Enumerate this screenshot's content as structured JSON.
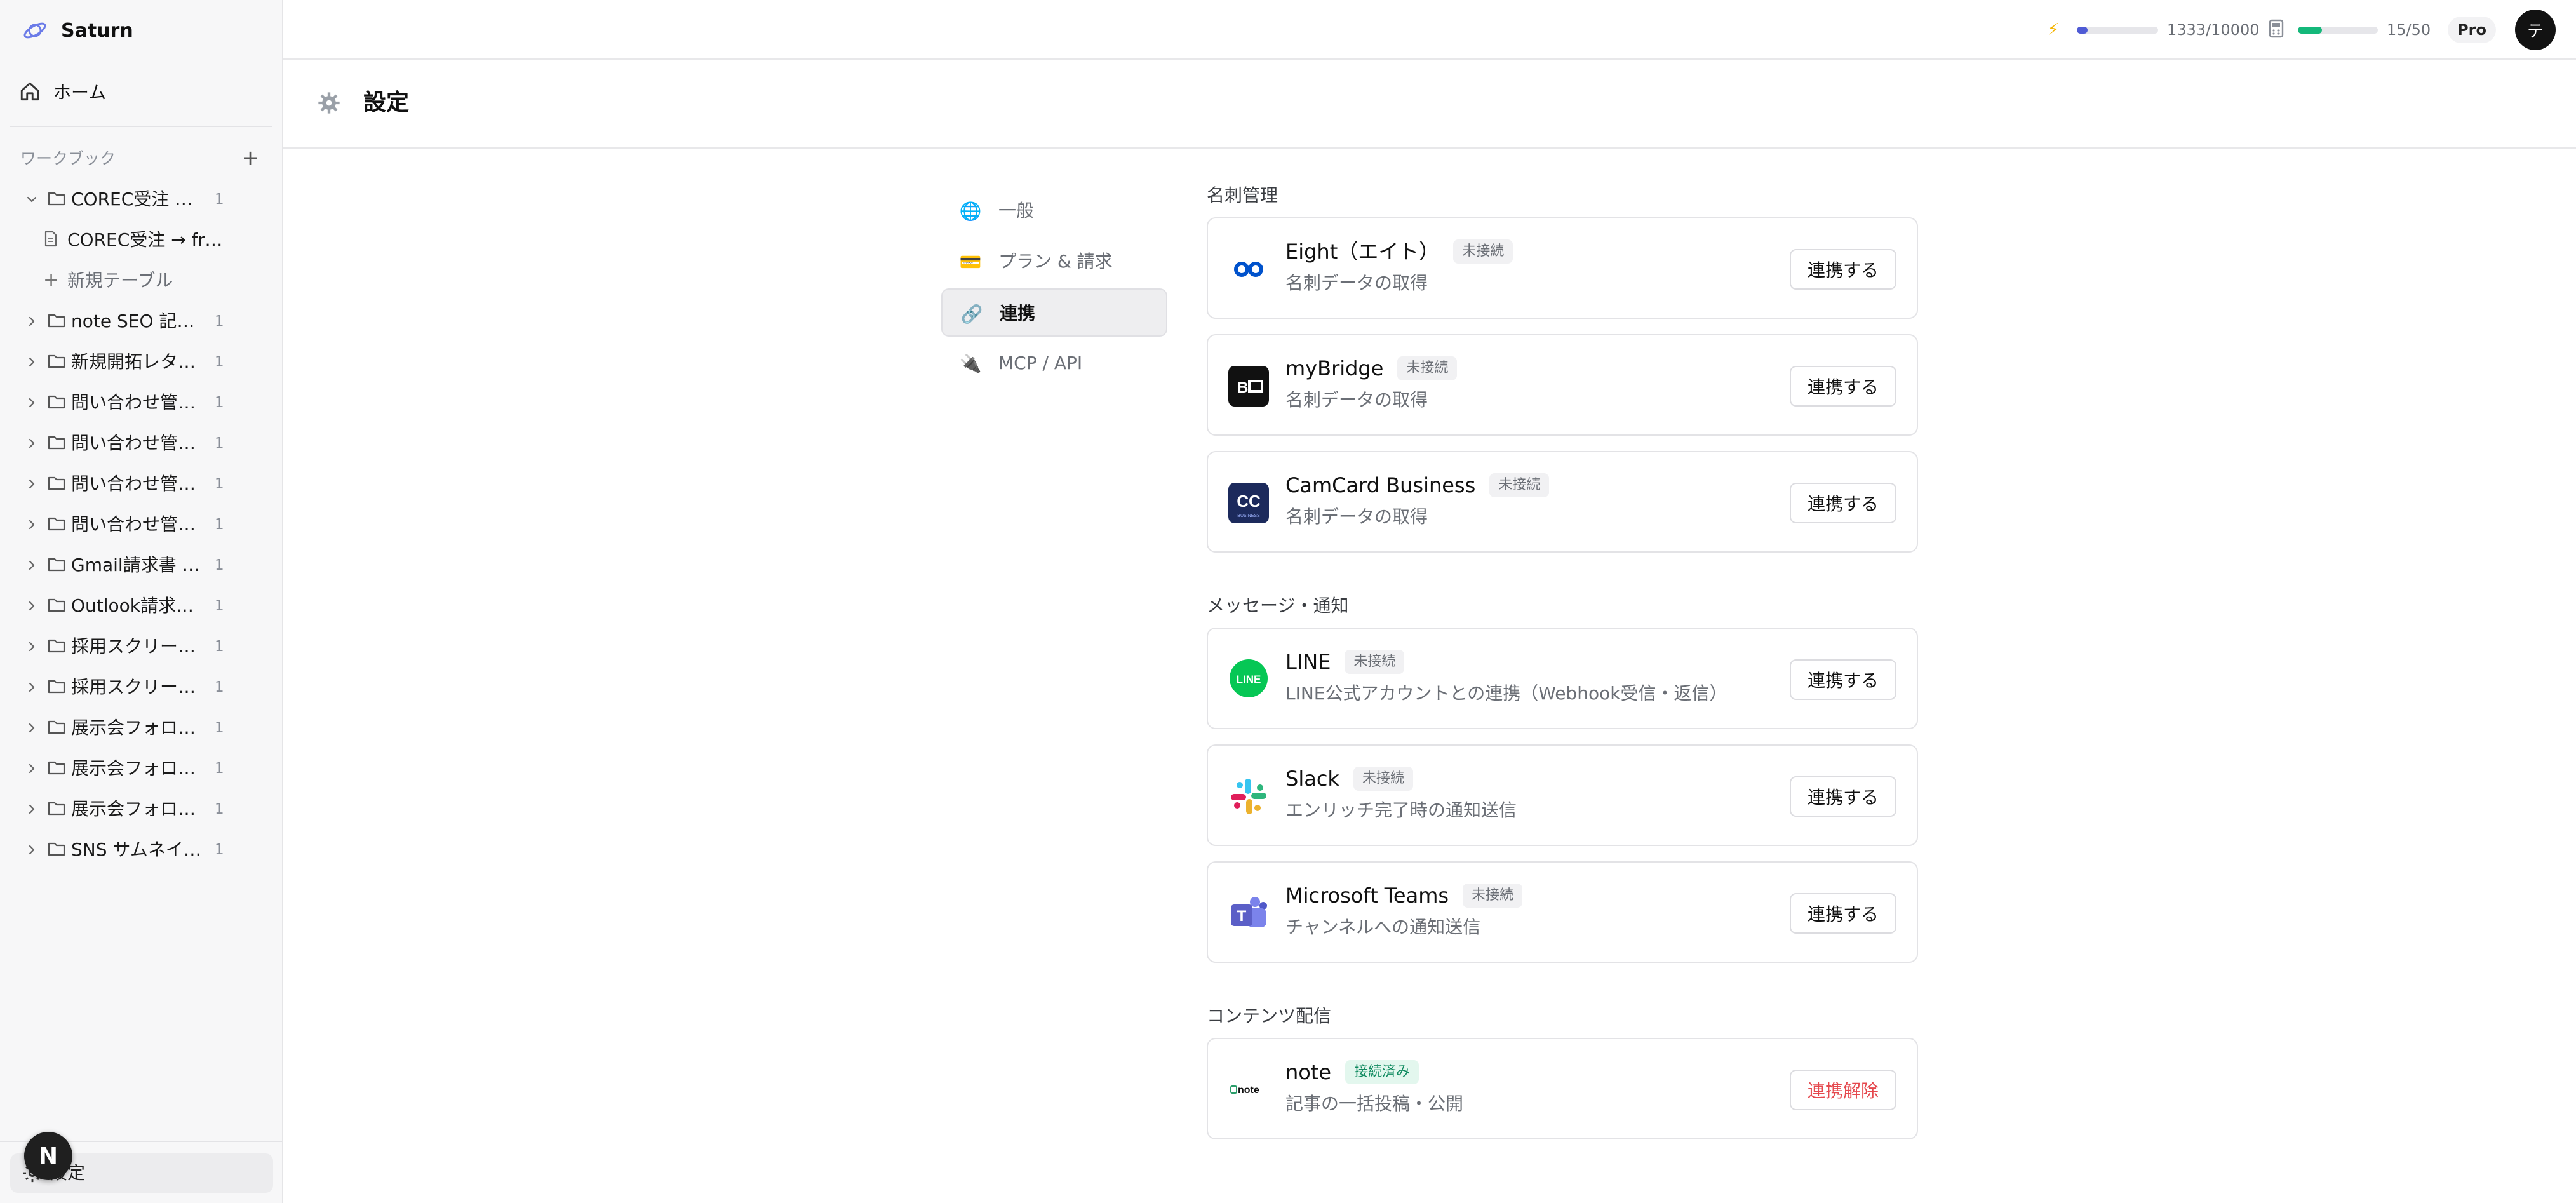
{
  "app": {
    "name": "Saturn"
  },
  "sidebar": {
    "home_label": "ホーム",
    "workbook_label": "ワークブック",
    "add_symbol": "+",
    "tree": [
      {
        "label": "COREC受注 → f...",
        "count": "1",
        "expanded": true
      },
      {
        "label": "COREC受注 → fre...",
        "child": true
      },
      {
        "label": "新規テーブル",
        "child": true,
        "new": true
      },
      {
        "label": "note SEO 記事...",
        "count": "1"
      },
      {
        "label": "新規開拓レター...",
        "count": "1"
      },
      {
        "label": "問い合わせ管理...",
        "count": "1"
      },
      {
        "label": "問い合わせ管理...",
        "count": "1"
      },
      {
        "label": "問い合わせ管理...",
        "count": "1"
      },
      {
        "label": "問い合わせ管理...",
        "count": "1"
      },
      {
        "label": "Gmail請求書 → ...",
        "count": "1"
      },
      {
        "label": "Outlook請求書 ...",
        "count": "1"
      },
      {
        "label": "採用スクリーニ...",
        "count": "1"
      },
      {
        "label": "採用スクリーニ...",
        "count": "1"
      },
      {
        "label": "展示会フォロー...",
        "count": "1"
      },
      {
        "label": "展示会フォロー...",
        "count": "1"
      },
      {
        "label": "展示会フォロー...",
        "count": "1"
      },
      {
        "label": "SNS サムネイル...",
        "count": "1"
      }
    ],
    "settings_label": "設定",
    "n_badge": "N"
  },
  "topbar": {
    "bolt": "⚡",
    "usage1": "1333/10000",
    "usage1_fraction": 0.1333,
    "usage2": "15/50",
    "usage2_fraction": 0.3,
    "plan": "Pro",
    "avatar_initial": "テ"
  },
  "page": {
    "title": "設定"
  },
  "settings_nav": [
    {
      "label": "一般",
      "icon": "globe-icon",
      "glyph": "🌐",
      "active": false
    },
    {
      "label": "プラン & 請求",
      "icon": "credit-card-icon",
      "glyph": "💳",
      "active": false
    },
    {
      "label": "連携",
      "icon": "link-icon",
      "glyph": "🔗",
      "active": true
    },
    {
      "label": "MCP / API",
      "icon": "plug-icon",
      "glyph": "🔌",
      "active": false
    }
  ],
  "sections": [
    {
      "title": "名刺管理",
      "items": [
        {
          "name": "Eight（エイト）",
          "status": "未接続",
          "connected": false,
          "desc": "名刺データの取得",
          "button": "連携する",
          "logo": "eight"
        },
        {
          "name": "myBridge",
          "status": "未接続",
          "connected": false,
          "desc": "名刺データの取得",
          "button": "連携する",
          "logo": "mybridge"
        },
        {
          "name": "CamCard Business",
          "status": "未接続",
          "connected": false,
          "desc": "名刺データの取得",
          "button": "連携する",
          "logo": "camcard"
        }
      ]
    },
    {
      "title": "メッセージ・通知",
      "items": [
        {
          "name": "LINE",
          "status": "未接続",
          "connected": false,
          "desc": "LINE公式アカウントとの連携（Webhook受信・返信）",
          "button": "連携する",
          "logo": "line"
        },
        {
          "name": "Slack",
          "status": "未接続",
          "connected": false,
          "desc": "エンリッチ完了時の通知送信",
          "button": "連携する",
          "logo": "slack"
        },
        {
          "name": "Microsoft Teams",
          "status": "未接続",
          "connected": false,
          "desc": "チャンネルへの通知送信",
          "button": "連携する",
          "logo": "teams"
        }
      ]
    },
    {
      "title": "コンテンツ配信",
      "items": [
        {
          "name": "note",
          "status": "接続済み",
          "connected": true,
          "desc": "記事の一括投稿・公開",
          "button": "連携解除",
          "logo": "note"
        }
      ]
    }
  ],
  "logos": {
    "mybridge_text": "B",
    "camcard_text": "CC",
    "camcard_sub": "BUSINESS",
    "line_text": "LINE",
    "teams_text": "T",
    "note_text": "note"
  },
  "colors": {
    "accent": "#4f5bd5",
    "success": "#14b87a",
    "danger": "#e5484d",
    "line_green": "#06c755",
    "teams_purple": "#5b5fc7",
    "eight_blue": "#0052cc"
  }
}
